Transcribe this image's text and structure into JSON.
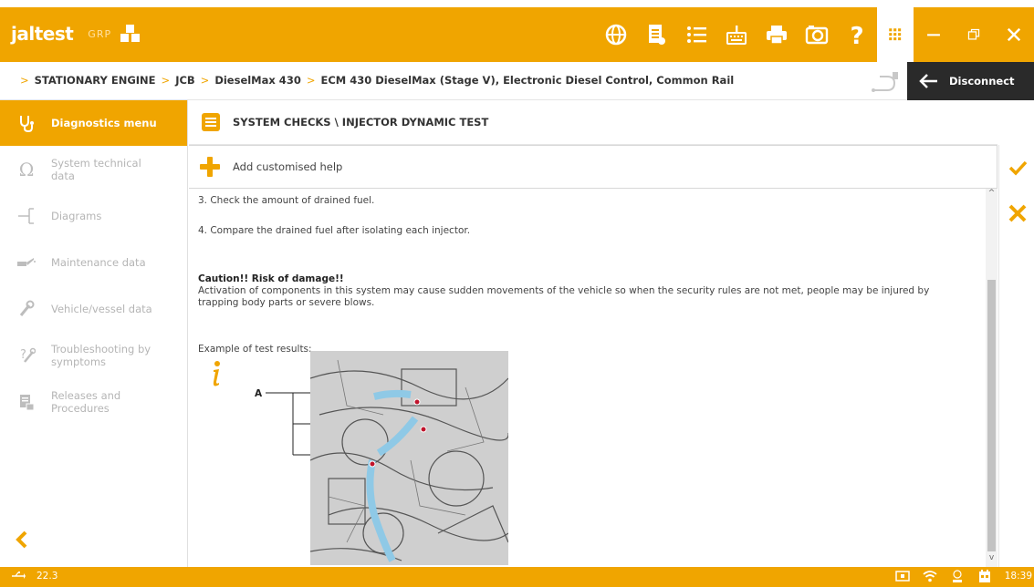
{
  "app": {
    "brand": "jaltest",
    "brand_sub": "GRP",
    "accent_color": "#f0a500"
  },
  "toolbar": {
    "icons": [
      "globe-icon",
      "document-icon",
      "list-icon",
      "keyboard-icon",
      "printer-icon",
      "camera-icon",
      "help-icon",
      "grid-icon",
      "minimize-icon",
      "restore-icon",
      "close-icon"
    ]
  },
  "breadcrumb": {
    "items": [
      "STATIONARY ENGINE",
      "JCB",
      "DieselMax 430",
      "ECM 430 DieselMax (Stage V), Electronic Diesel Control, Common Rail"
    ]
  },
  "disconnect": {
    "label": "Disconnect"
  },
  "sidebar": {
    "items": [
      {
        "label": "Diagnostics menu",
        "icon": "stethoscope-icon"
      },
      {
        "label": "System technical data",
        "icon": "omega-icon"
      },
      {
        "label": "Diagrams",
        "icon": "diagram-icon"
      },
      {
        "label": "Maintenance data",
        "icon": "oil-can-icon"
      },
      {
        "label": "Vehicle/vessel data",
        "icon": "wrench-icon"
      },
      {
        "label": "Troubleshooting by symptoms",
        "icon": "tools-icon"
      },
      {
        "label": "Releases and Procedures",
        "icon": "book-icon"
      }
    ]
  },
  "main": {
    "title": "SYSTEM CHECKS \\ INJECTOR DYNAMIC TEST",
    "help_label": "Add customised help",
    "step3": "3. Check the amount of drained fuel.",
    "step4": "4. Compare the drained fuel after isolating each injector.",
    "caution_title": "Caution!! Risk of damage!!",
    "caution_text": "Activation of components in this system may cause sudden movements of the vehicle so when the security rules are not met, people may be injured by trapping body parts or severe blows.",
    "example_label": "Example of test results:",
    "diagram_label": "A"
  },
  "status": {
    "left_value": "22.3",
    "time": "18:39"
  }
}
